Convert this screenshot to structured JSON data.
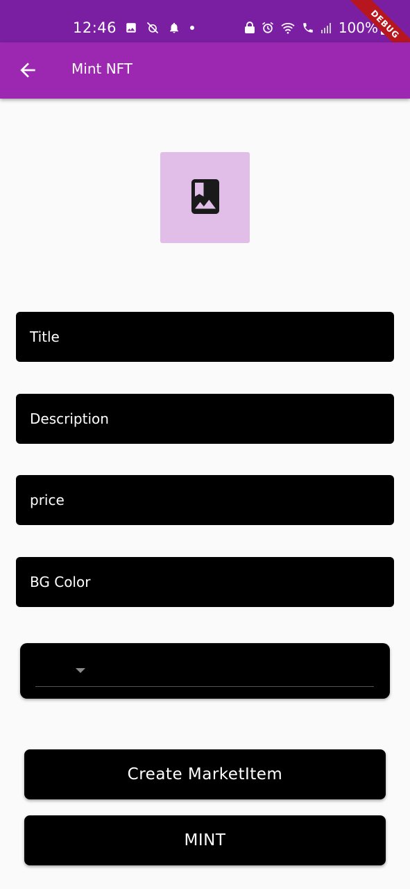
{
  "status_bar": {
    "time": "12:46",
    "battery": "100%",
    "left_icons": [
      "image-icon",
      "alarm-off-icon",
      "bell-icon",
      "dot-icon"
    ],
    "right_icons": [
      "lock-icon",
      "alarm-icon",
      "wifi-icon",
      "call-icon",
      "signal-icon",
      "battery-icon"
    ]
  },
  "debug_banner": "DEBUG",
  "app_bar": {
    "title": "Mint NFT",
    "back_icon": "arrow-back-icon"
  },
  "image_picker": {
    "icon": "photo-album-icon",
    "background": "#e1bee7"
  },
  "form": {
    "title_placeholder": "Title",
    "description_placeholder": "Description",
    "price_placeholder": "price",
    "bg_color_placeholder": "BG Color",
    "dropdown_value": ""
  },
  "buttons": {
    "create_market_item": "Create MarketItem",
    "mint": "MINT"
  },
  "colors": {
    "status_bar": "#7b1fa2",
    "app_bar": "#9c27b0",
    "field_bg": "#000000",
    "page_bg": "#fafafa"
  }
}
